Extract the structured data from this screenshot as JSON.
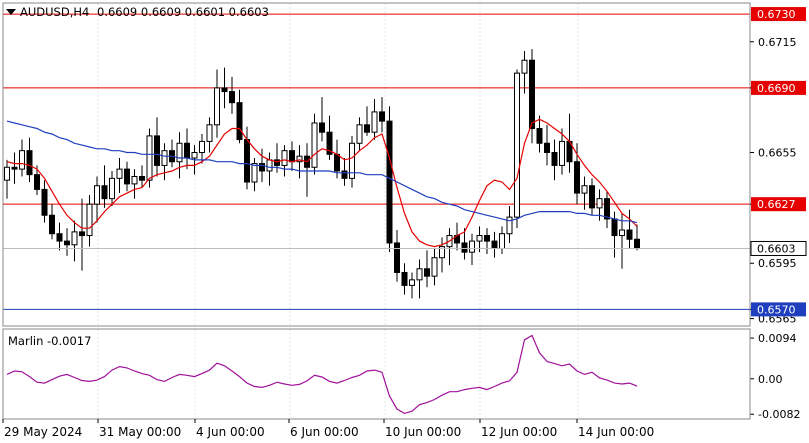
{
  "header": {
    "symbol_tf": "AUDUSD,H4",
    "ohlc": "0.6609 0.6609 0.6601 0.6603"
  },
  "chart_data": [
    {
      "type": "candlestick",
      "title": "AUDUSD,H4",
      "ylim": [
        0.6561,
        0.6736
      ],
      "y_ticks": [
        "0.6715",
        "0.6690",
        "0.6655",
        "0.6627",
        "0.6595",
        "0.6570",
        "0.6565"
      ],
      "x_tick_labels": [
        "29 May 2024",
        "31 May 00:00",
        "4 Jun 00:00",
        "6 Jun 00:00",
        "10 Jun 00:00",
        "12 Jun 00:00",
        "14 Jun 00:00"
      ],
      "current_price": "0.6603",
      "levels": [
        {
          "value": 0.673,
          "label": "0.6730",
          "color": "#e60000"
        },
        {
          "value": 0.669,
          "label": "0.6690",
          "color": "#e60000"
        },
        {
          "value": 0.6627,
          "label": "0.6627",
          "color": "#e60000"
        },
        {
          "value": 0.657,
          "label": "0.6570",
          "color": "#1f3fbf"
        }
      ],
      "candles": [
        [
          0.664,
          0.6651,
          0.663,
          0.6647
        ],
        [
          0.6647,
          0.6655,
          0.6638,
          0.6646
        ],
        [
          0.6646,
          0.6662,
          0.6642,
          0.6656
        ],
        [
          0.6656,
          0.6663,
          0.6639,
          0.6643
        ],
        [
          0.6643,
          0.6648,
          0.6632,
          0.6635
        ],
        [
          0.6635,
          0.664,
          0.6617,
          0.6621
        ],
        [
          0.6621,
          0.6627,
          0.6608,
          0.6611
        ],
        [
          0.6611,
          0.6617,
          0.6602,
          0.6607
        ],
        [
          0.6607,
          0.6614,
          0.6599,
          0.6605
        ],
        [
          0.6605,
          0.6618,
          0.6596,
          0.6612
        ],
        [
          0.6612,
          0.663,
          0.6591,
          0.661
        ],
        [
          0.661,
          0.6632,
          0.6604,
          0.6627
        ],
        [
          0.6627,
          0.6642,
          0.6617,
          0.6637
        ],
        [
          0.6637,
          0.6648,
          0.6625,
          0.663
        ],
        [
          0.663,
          0.6645,
          0.6626,
          0.6641
        ],
        [
          0.6641,
          0.6652,
          0.6633,
          0.6646
        ],
        [
          0.6646,
          0.665,
          0.6634,
          0.6638
        ],
        [
          0.6638,
          0.6646,
          0.663,
          0.6642
        ],
        [
          0.6642,
          0.6648,
          0.6636,
          0.664
        ],
        [
          0.664,
          0.6668,
          0.6636,
          0.6664
        ],
        [
          0.6664,
          0.6674,
          0.6642,
          0.6648
        ],
        [
          0.6648,
          0.666,
          0.664,
          0.6656
        ],
        [
          0.6656,
          0.6662,
          0.6647,
          0.665
        ],
        [
          0.665,
          0.6666,
          0.6641,
          0.666
        ],
        [
          0.666,
          0.6668,
          0.6646,
          0.6652
        ],
        [
          0.6652,
          0.6659,
          0.6643,
          0.6655
        ],
        [
          0.6655,
          0.6665,
          0.6649,
          0.6661
        ],
        [
          0.6661,
          0.6674,
          0.6655,
          0.667
        ],
        [
          0.667,
          0.67,
          0.6663,
          0.669
        ],
        [
          0.669,
          0.6701,
          0.6679,
          0.6688
        ],
        [
          0.6688,
          0.6696,
          0.6676,
          0.6682
        ],
        [
          0.6682,
          0.6689,
          0.666,
          0.6662
        ],
        [
          0.6662,
          0.6669,
          0.6635,
          0.6639
        ],
        [
          0.6639,
          0.6652,
          0.6634,
          0.6649
        ],
        [
          0.6649,
          0.6657,
          0.6639,
          0.6645
        ],
        [
          0.6645,
          0.6655,
          0.6637,
          0.6651
        ],
        [
          0.6651,
          0.666,
          0.6644,
          0.6648
        ],
        [
          0.6648,
          0.6659,
          0.6642,
          0.6656
        ],
        [
          0.6656,
          0.6661,
          0.6645,
          0.665
        ],
        [
          0.665,
          0.6659,
          0.6641,
          0.6653
        ],
        [
          0.6653,
          0.666,
          0.6631,
          0.6647
        ],
        [
          0.6647,
          0.6676,
          0.6643,
          0.6671
        ],
        [
          0.6671,
          0.6685,
          0.6661,
          0.6666
        ],
        [
          0.6666,
          0.6675,
          0.6651,
          0.6654
        ],
        [
          0.6654,
          0.6662,
          0.6641,
          0.6645
        ],
        [
          0.6645,
          0.6652,
          0.6637,
          0.6641
        ],
        [
          0.6641,
          0.6664,
          0.6636,
          0.666
        ],
        [
          0.666,
          0.6674,
          0.6656,
          0.667
        ],
        [
          0.667,
          0.668,
          0.6664,
          0.6666
        ],
        [
          0.6666,
          0.6684,
          0.6662,
          0.6677
        ],
        [
          0.6677,
          0.6685,
          0.6666,
          0.6672
        ],
        [
          0.6672,
          0.668,
          0.6601,
          0.6606
        ],
        [
          0.6606,
          0.6613,
          0.6585,
          0.659
        ],
        [
          0.659,
          0.6595,
          0.6578,
          0.6583
        ],
        [
          0.6583,
          0.659,
          0.6576,
          0.6586
        ],
        [
          0.6586,
          0.6597,
          0.6576,
          0.6592
        ],
        [
          0.6592,
          0.6602,
          0.6582,
          0.6588
        ],
        [
          0.6588,
          0.6603,
          0.6583,
          0.6598
        ],
        [
          0.6598,
          0.6609,
          0.659,
          0.6604
        ],
        [
          0.6604,
          0.6614,
          0.6594,
          0.661
        ],
        [
          0.661,
          0.6617,
          0.6602,
          0.6606
        ],
        [
          0.6606,
          0.6614,
          0.6597,
          0.6601
        ],
        [
          0.6601,
          0.6611,
          0.6594,
          0.6607
        ],
        [
          0.6607,
          0.6615,
          0.6601,
          0.661
        ],
        [
          0.661,
          0.6614,
          0.66,
          0.6607
        ],
        [
          0.6607,
          0.6612,
          0.6598,
          0.6603
        ],
        [
          0.6603,
          0.6615,
          0.66,
          0.6611
        ],
        [
          0.6611,
          0.6626,
          0.6606,
          0.662
        ],
        [
          0.662,
          0.67,
          0.6614,
          0.6698
        ],
        [
          0.6698,
          0.671,
          0.6687,
          0.6705
        ],
        [
          0.6705,
          0.6711,
          0.666,
          0.6668
        ],
        [
          0.6668,
          0.6675,
          0.6655,
          0.666
        ],
        [
          0.666,
          0.667,
          0.6648,
          0.6655
        ],
        [
          0.6655,
          0.6662,
          0.664,
          0.6648
        ],
        [
          0.6648,
          0.6668,
          0.6643,
          0.6661
        ],
        [
          0.6661,
          0.6676,
          0.6644,
          0.665
        ],
        [
          0.665,
          0.666,
          0.6627,
          0.6633
        ],
        [
          0.6633,
          0.6642,
          0.6624,
          0.6637
        ],
        [
          0.6637,
          0.6641,
          0.6621,
          0.6625
        ],
        [
          0.6625,
          0.6635,
          0.6618,
          0.663
        ],
        [
          0.663,
          0.6634,
          0.6614,
          0.6619
        ],
        [
          0.6619,
          0.6623,
          0.6598,
          0.661
        ],
        [
          0.661,
          0.6622,
          0.6592,
          0.6613
        ],
        [
          0.6613,
          0.6624,
          0.6603,
          0.6608
        ],
        [
          0.6608,
          0.6616,
          0.6602,
          0.6603
        ]
      ],
      "series": [
        {
          "name": "",
          "color": "#e60000",
          "values": [
            0.665,
            0.6649,
            0.6649,
            0.6648,
            0.6646,
            0.6641,
            0.6634,
            0.6627,
            0.6621,
            0.6617,
            0.6614,
            0.6614,
            0.6618,
            0.6623,
            0.6627,
            0.6631,
            0.6633,
            0.6635,
            0.6636,
            0.6641,
            0.6643,
            0.6644,
            0.6645,
            0.6647,
            0.6648,
            0.6648,
            0.665,
            0.6653,
            0.6659,
            0.6665,
            0.6668,
            0.6668,
            0.6662,
            0.6657,
            0.6653,
            0.6651,
            0.665,
            0.6651,
            0.665,
            0.6651,
            0.665,
            0.6654,
            0.6657,
            0.6656,
            0.6654,
            0.6651,
            0.6652,
            0.6656,
            0.6659,
            0.6663,
            0.6665,
            0.6652,
            0.6636,
            0.6622,
            0.6612,
            0.6607,
            0.6605,
            0.6604,
            0.6605,
            0.6607,
            0.661,
            0.6612,
            0.662,
            0.6629,
            0.6637,
            0.664,
            0.6639,
            0.6635,
            0.6641,
            0.666,
            0.6671,
            0.6673,
            0.6671,
            0.6668,
            0.6665,
            0.6661,
            0.6654,
            0.6648,
            0.6643,
            0.6639,
            0.6634,
            0.6628,
            0.6622,
            0.6619,
            0.6615
          ]
        },
        {
          "name": "",
          "color": "#1f3fbf",
          "values": [
            0.6672,
            0.6671,
            0.667,
            0.6669,
            0.6668,
            0.6666,
            0.6665,
            0.6663,
            0.6662,
            0.666,
            0.6659,
            0.6658,
            0.6657,
            0.6657,
            0.6656,
            0.6656,
            0.6655,
            0.6655,
            0.6654,
            0.6654,
            0.6654,
            0.6653,
            0.6653,
            0.6652,
            0.6652,
            0.6651,
            0.6651,
            0.6651,
            0.665,
            0.665,
            0.665,
            0.6649,
            0.6649,
            0.6648,
            0.6648,
            0.6647,
            0.6647,
            0.6646,
            0.6646,
            0.6645,
            0.6645,
            0.6645,
            0.6645,
            0.6645,
            0.6644,
            0.6644,
            0.6644,
            0.6644,
            0.6643,
            0.6643,
            0.6643,
            0.6641,
            0.6639,
            0.6637,
            0.6635,
            0.6633,
            0.6631,
            0.663,
            0.6628,
            0.6627,
            0.6626,
            0.6624,
            0.6623,
            0.6622,
            0.6621,
            0.662,
            0.6619,
            0.6618,
            0.6619,
            0.6621,
            0.6622,
            0.6623,
            0.6623,
            0.6623,
            0.6623,
            0.6623,
            0.6622,
            0.6622,
            0.6621,
            0.6621,
            0.662,
            0.6619,
            0.6618,
            0.6618,
            0.6617
          ]
        }
      ]
    },
    {
      "type": "line",
      "title": "Marlin -0.0017",
      "ylim": [
        -0.0093,
        0.0115
      ],
      "y_ticks": [
        "0.0094",
        "0.00",
        "-0.0082"
      ],
      "series": [
        {
          "name": "Marlin",
          "color": "#a0109a",
          "values": [
            0.001,
            0.0018,
            0.0016,
            0.0005,
            -0.0008,
            -0.001,
            -0.0002,
            0.0006,
            0.001,
            0.0003,
            -0.0004,
            -0.0006,
            -0.0003,
            0.0005,
            0.002,
            0.0028,
            0.0025,
            0.0018,
            0.0012,
            0.0008,
            -0.0002,
            -0.0006,
            0.0003,
            0.001,
            0.0008,
            0.0005,
            0.0012,
            0.002,
            0.0036,
            0.003,
            0.0018,
            0.0005,
            -0.001,
            -0.0018,
            -0.002,
            -0.0015,
            -0.0008,
            -0.0012,
            -0.0015,
            -0.0013,
            -0.0005,
            0.0008,
            0.0004,
            -0.0006,
            -0.001,
            -0.0004,
            0.0003,
            0.0008,
            0.0018,
            0.002,
            0.0015,
            -0.004,
            -0.007,
            -0.008,
            -0.0075,
            -0.006,
            -0.0055,
            -0.0048,
            -0.0038,
            -0.003,
            -0.003,
            -0.0025,
            -0.0022,
            -0.002,
            -0.0025,
            -0.0018,
            -0.001,
            -0.0005,
            0.0015,
            0.009,
            0.01,
            0.006,
            0.004,
            0.0035,
            0.003,
            0.0034,
            0.0018,
            0.001,
            0.0015,
            0.0002,
            -0.0003,
            -0.001,
            -0.0012,
            -0.001,
            -0.0017
          ]
        }
      ]
    }
  ]
}
